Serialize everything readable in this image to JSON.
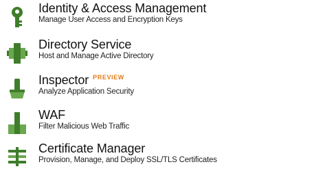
{
  "colors": {
    "icon_green": "#3f7d2a",
    "icon_green_light": "#6aa84f",
    "badge_orange": "#e07b1a"
  },
  "services": [
    {
      "name": "Identity & Access Management",
      "description": "Manage User Access and Encryption Keys",
      "icon": "key-icon"
    },
    {
      "name": "Directory Service",
      "description": "Host and Manage Active Directory",
      "icon": "directory-icon"
    },
    {
      "name": "Inspector",
      "badge": "PREVIEW",
      "description": "Analyze Application Security",
      "icon": "inspector-icon"
    },
    {
      "name": "WAF",
      "description": "Filter Malicious Web Traffic",
      "icon": "waf-icon"
    },
    {
      "name": "Certificate Manager",
      "description": "Provision, Manage, and Deploy SSL/TLS Certificates",
      "icon": "certificate-icon"
    }
  ]
}
